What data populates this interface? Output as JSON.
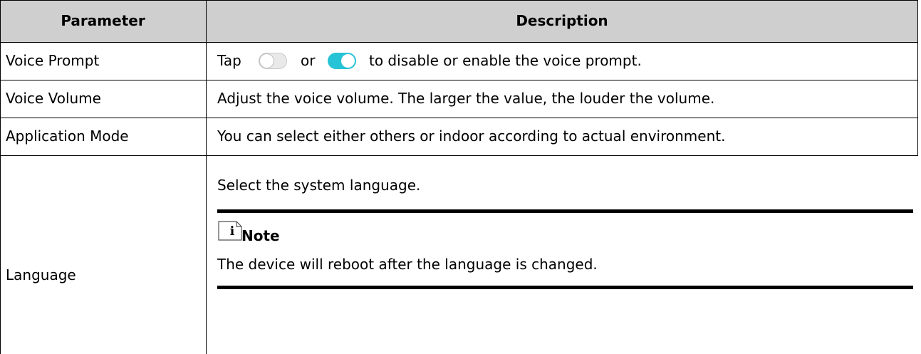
{
  "table": {
    "headers": {
      "parameter": "Parameter",
      "description": "Description"
    },
    "rows": [
      {
        "parameter": "Voice Prompt",
        "description_prefix": "Tap",
        "description_middle": "or",
        "description_suffix": "to disable or enable the voice prompt."
      },
      {
        "parameter": "Voice Volume",
        "description": "Adjust the voice volume. The larger the value, the louder the volume."
      },
      {
        "parameter": "Application Mode",
        "description": "You can select either others or indoor according to actual environment."
      },
      {
        "parameter": "Language",
        "description": "Select the system language."
      }
    ],
    "note": {
      "title": "Note",
      "text": "The device will reboot after the language is changed.",
      "icon": "info-note-icon"
    }
  },
  "colors": {
    "header_bg": "#cfcfcf",
    "toggle_on": "#27c3d6",
    "toggle_off": "#e9e9e9"
  }
}
